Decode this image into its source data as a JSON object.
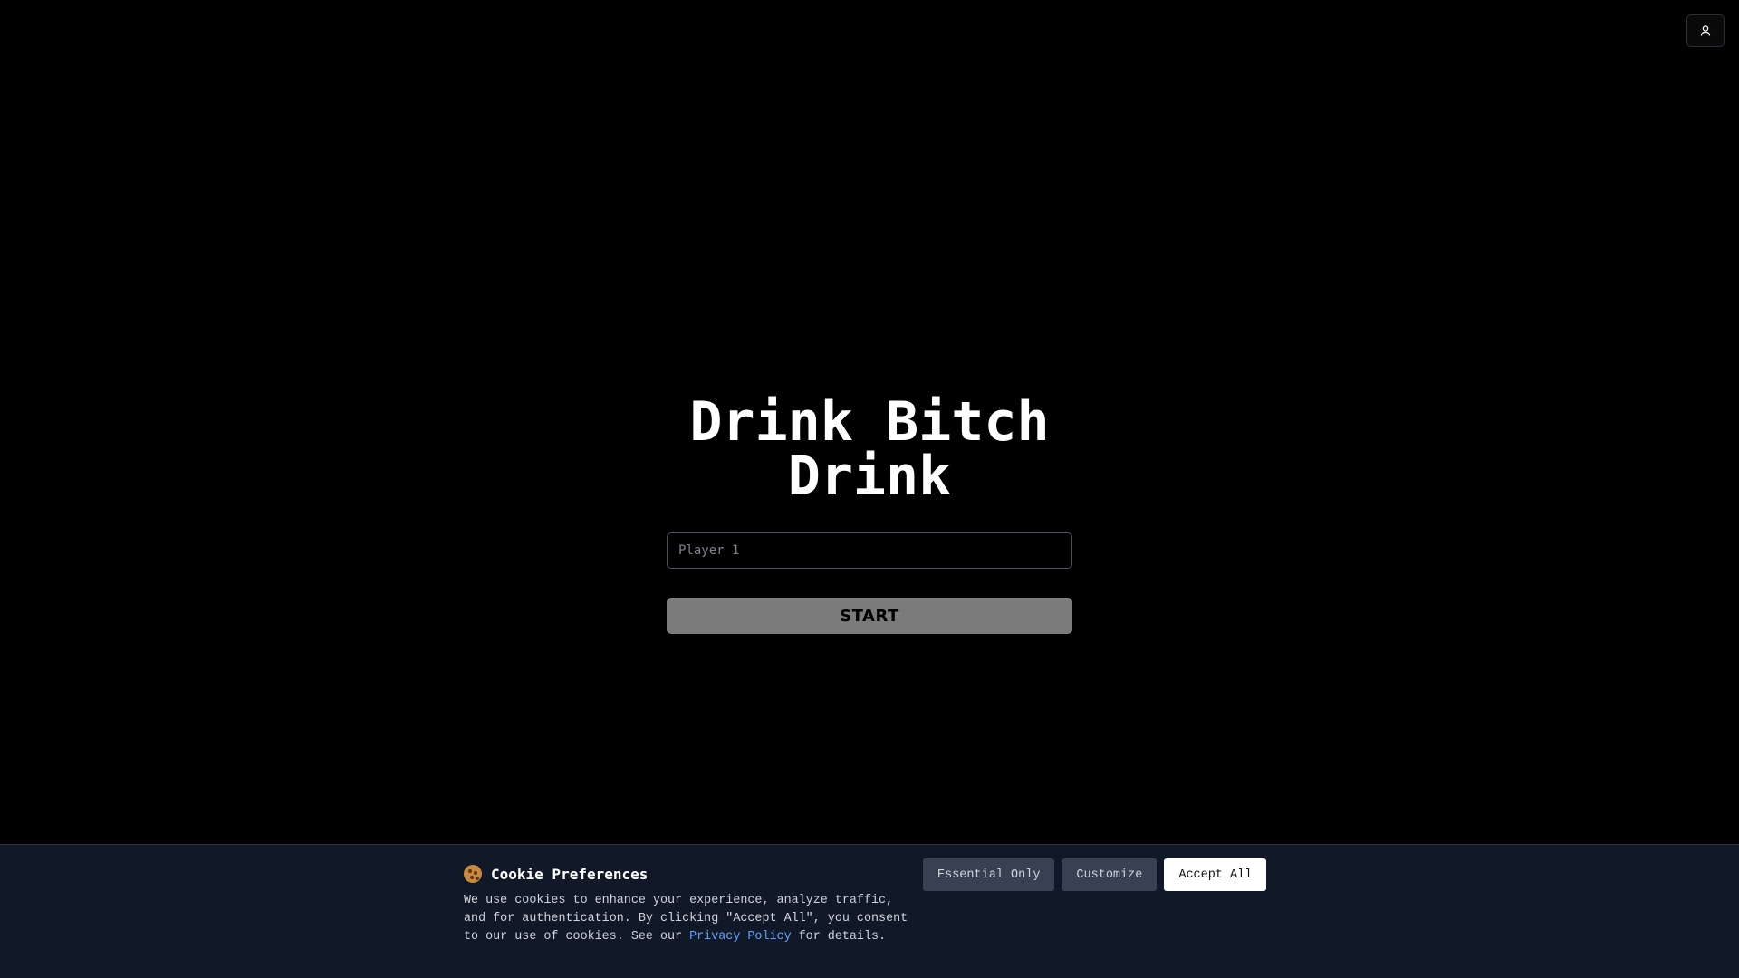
{
  "header": {
    "account_icon": "user-icon"
  },
  "main": {
    "title": "Drink Bitch Drink",
    "player_input": {
      "placeholder": "Player 1",
      "value": ""
    },
    "start_label": "START"
  },
  "cookie_banner": {
    "icon": "cookie-icon",
    "heading": "Cookie Preferences",
    "body_before_link": "We use cookies to enhance your experience, analyze traffic, and for authentication. By clicking \"Accept All\", you consent to our use of cookies. See our ",
    "link_label": "Privacy Policy",
    "body_after_link": " for details.",
    "buttons": {
      "essential_label": "Essential Only",
      "customize_label": "Customize",
      "accept_label": "Accept All"
    }
  },
  "colors": {
    "background": "#000000",
    "banner_background": "#111827",
    "start_button": "#7b7b7b",
    "link": "#60a5fa",
    "secondary_button": "#374151"
  }
}
